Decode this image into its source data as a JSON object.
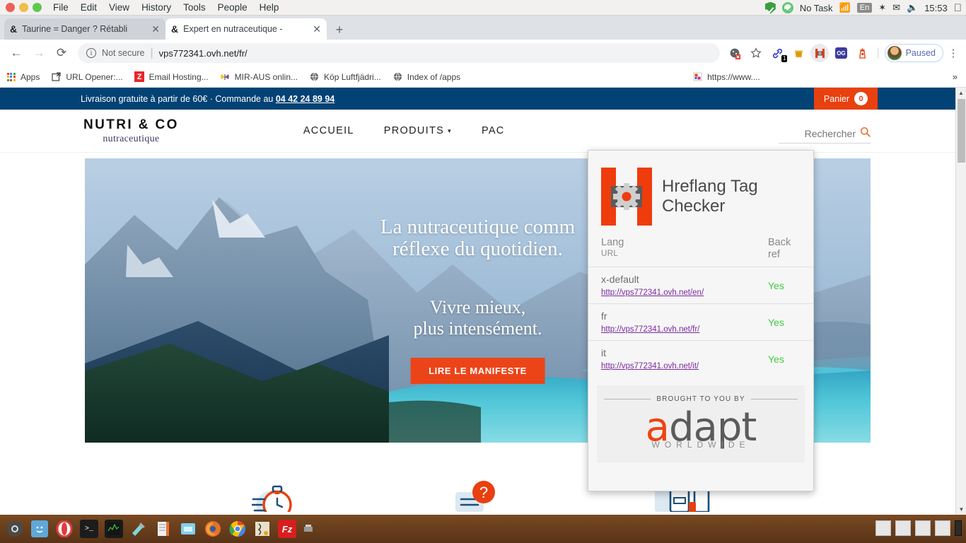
{
  "os": {
    "menu": [
      "File",
      "Edit",
      "View",
      "History",
      "Tools",
      "People",
      "Help"
    ],
    "tray": {
      "task": "No Task",
      "lang": "En",
      "clock": "15:53"
    }
  },
  "browser": {
    "tabs": [
      {
        "favicon": "&",
        "title": "Taurine = Danger ? Rétabli",
        "active": false,
        "close": "✕"
      },
      {
        "favicon": "&",
        "title": "Expert en nutraceutique -",
        "active": true,
        "close": "✕"
      }
    ],
    "new_tab_label": "+",
    "nav": {
      "back": "←",
      "forward": "→",
      "reload": "⟳"
    },
    "omnibox": {
      "info_glyph": "i",
      "security_label": "Not secure",
      "separator": "|",
      "url": "vps772341.ovh.net/fr/"
    },
    "toolbar_icons": [
      {
        "name": "cookie-blocked-icon",
        "glyph": "🍪"
      },
      {
        "name": "bookmark-star-icon",
        "glyph": "☆"
      },
      {
        "name": "link-extension-icon",
        "glyph": "🔗",
        "badge": "1"
      },
      {
        "name": "honey-extension-icon",
        "glyph": "🍯"
      },
      {
        "name": "hreflang-extension-icon",
        "glyph": "H"
      },
      {
        "name": "og-extension-icon",
        "glyph": "OG"
      },
      {
        "name": "lighthouse-extension-icon",
        "glyph": "🔒"
      }
    ],
    "profile": {
      "label": "Paused"
    },
    "menu_glyph": "⋮",
    "bookmarks": [
      {
        "label": "Apps",
        "icon": "apps-grid-icon"
      },
      {
        "label": "URL Opener:...",
        "icon": "external-link-icon"
      },
      {
        "label": "Email Hosting...",
        "icon": "zoho-icon"
      },
      {
        "label": "MIR-AUS onlin...",
        "icon": "butterfly-icon"
      },
      {
        "label": "Köp Luftfjädri...",
        "icon": "globe-icon"
      },
      {
        "label": "Index of /apps",
        "icon": "globe-icon"
      },
      {
        "label": "https://www....",
        "icon": "page-icon"
      }
    ],
    "bookmarks_overflow": "»"
  },
  "site": {
    "promo": {
      "text_before": "Livraison gratuite à partir de 60€ · Commande au ",
      "phone": "04 42 24 89 94"
    },
    "cart": {
      "label": "Panier",
      "count": "0"
    },
    "logo": {
      "main": "NUTRI & CO",
      "sub": "nutraceutique"
    },
    "nav": [
      {
        "label": "ACCUEIL",
        "caret": ""
      },
      {
        "label": "PRODUITS",
        "caret": "▾"
      },
      {
        "label": "PAC",
        "caret": ""
      }
    ],
    "search": {
      "value": "",
      "placeholder": "Rechercher",
      "icon": "search-icon"
    },
    "hero": {
      "line1": "La nutraceutique comm",
      "line2": "réflexe du quotidien.",
      "line3": "Vivre mieux,",
      "line4": "plus intensément.",
      "cta": "LIRE LE MANIFESTE"
    },
    "features": [
      {
        "name": "stopwatch-icon"
      },
      {
        "name": "question-bubble-icon"
      },
      {
        "name": "supplement-bottles-icon"
      }
    ]
  },
  "popup": {
    "title_line1": "Hreflang Tag",
    "title_line2": "Checker",
    "logo_name": "hreflang-logo",
    "headers": {
      "lang": "Lang",
      "url": "URL",
      "backref_line1": "Back",
      "backref_line2": "ref"
    },
    "rows": [
      {
        "lang": "x-default",
        "url": "http://vps772341.ovh.net/en/",
        "backref": "Yes"
      },
      {
        "lang": "fr",
        "url": "http://vps772341.ovh.net/fr/",
        "backref": "Yes"
      },
      {
        "lang": "it",
        "url": "http://vps772341.ovh.net/it/",
        "backref": "Yes"
      }
    ],
    "footer": {
      "brought": "BROUGHT  TO YOU BY",
      "brand_a": "a",
      "brand_rest": "dapt",
      "brand_sub": "WORLDWIDE"
    }
  },
  "scrollbar": {
    "up": "▲",
    "down": "▼"
  },
  "colors": {
    "promo_blue": "#034274",
    "cart_orange": "#e8400f",
    "cta_orange": "#ec4419",
    "hreflang_orange": "#ef3c0d",
    "yes_green": "#3ecb3e",
    "visited_link": "#7a2aa0"
  }
}
